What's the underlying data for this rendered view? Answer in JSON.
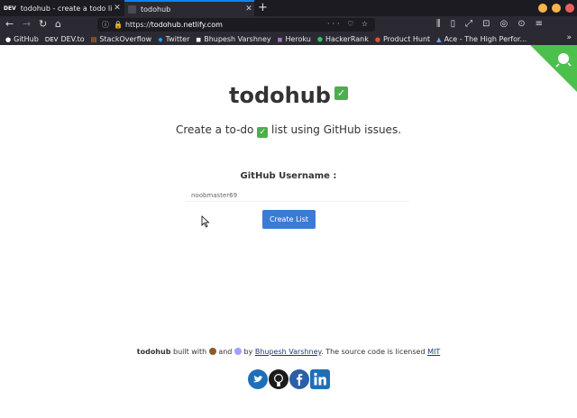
{
  "browser": {
    "tabs": [
      {
        "favicon": "DEV",
        "title": "todohub - create a todo list",
        "active": false
      },
      {
        "favicon": "",
        "title": "todohub",
        "active": true
      }
    ],
    "url": {
      "scheme": "https://",
      "host": "todohub.netlify.com"
    },
    "bookmarks": [
      {
        "icon": "github-icon",
        "label": "GitHub"
      },
      {
        "icon": "DEV",
        "label": "DEV.to"
      },
      {
        "icon": "stackoverflow-icon",
        "label": "StackOverflow"
      },
      {
        "icon": "twitter-icon",
        "label": "Twitter"
      },
      {
        "icon": "bookmark-icon",
        "label": "Bhupesh Varshney"
      },
      {
        "icon": "heroku-icon",
        "label": "Heroku"
      },
      {
        "icon": "hackerrank-icon",
        "label": "HackerRank"
      },
      {
        "icon": "producthunt-icon",
        "label": "Product Hunt"
      },
      {
        "icon": "ace-icon",
        "label": "Ace - The High Perfor..."
      }
    ]
  },
  "page": {
    "title": "todohub",
    "subtitle_before": "Create a to-do",
    "subtitle_after": "list using GitHub issues.",
    "username_label": "GitHub Username :",
    "username_value": "noobmaster69",
    "create_button": "Create List",
    "footer": {
      "brand": "todohub",
      "built_with": "built with",
      "and": "and",
      "by": "by",
      "author": "Bhupesh Varshney",
      "license_text": ". The source code is licensed",
      "license": "MIT"
    },
    "social": [
      "twitter-icon",
      "github-icon",
      "facebook-icon",
      "linkedin-icon"
    ]
  },
  "colors": {
    "accent_button": "#3b7bd4",
    "corner_ribbon": "#4cc04c",
    "check": "#4cae4c"
  }
}
